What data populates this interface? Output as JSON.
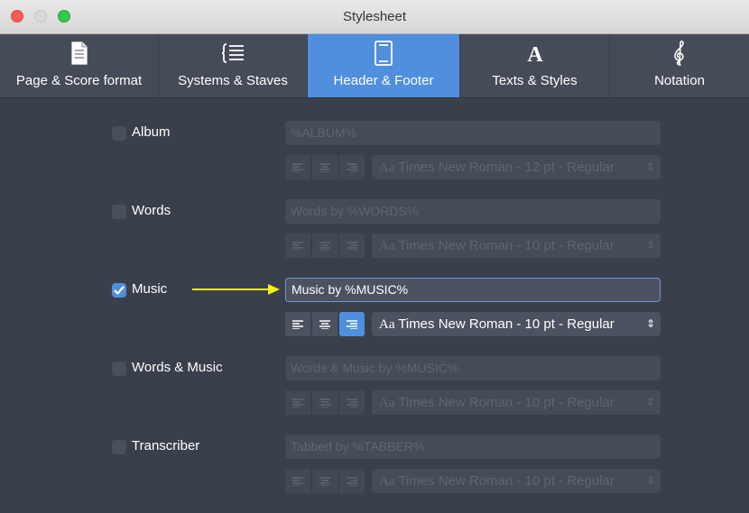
{
  "window": {
    "title": "Stylesheet"
  },
  "tabs": [
    {
      "label": "Page & Score format",
      "icon": "page-icon",
      "active": false
    },
    {
      "label": "Systems & Staves",
      "icon": "systems-staves-icon",
      "active": false
    },
    {
      "label": "Header & Footer",
      "icon": "header-footer-icon",
      "active": true
    },
    {
      "label": "Texts & Styles",
      "icon": "text-a-icon",
      "active": false
    },
    {
      "label": "Notation",
      "icon": "treble-clef-icon",
      "active": false
    }
  ],
  "fields": [
    {
      "label": "Album",
      "checked": false,
      "value": "%ALBUM%",
      "align": "",
      "font_prefix": "Aa",
      "font": "Times New Roman - 12 pt - Regular"
    },
    {
      "label": "Words",
      "checked": false,
      "value": "Words by %WORDS%",
      "align": "",
      "font_prefix": "Aa",
      "font": "Times New Roman - 10 pt - Regular"
    },
    {
      "label": "Music",
      "checked": true,
      "value": "Music by %MUSIC%",
      "align": "right",
      "font_prefix": "Aa",
      "font": "Times New Roman - 10 pt - Regular"
    },
    {
      "label": "Words & Music",
      "checked": false,
      "value": "Words & Music by %MUSIC%",
      "align": "",
      "font_prefix": "Aa",
      "font": "Times New Roman - 10 pt - Regular"
    },
    {
      "label": "Transcriber",
      "checked": false,
      "value": "Tabbed by %TABBER%",
      "align": "",
      "font_prefix": "Aa",
      "font": "Times New Roman - 10 pt - Regular"
    }
  ],
  "colors": {
    "accent": "#4f8fde",
    "annotation_arrow": "#f2f20a",
    "background": "#3a404b"
  }
}
